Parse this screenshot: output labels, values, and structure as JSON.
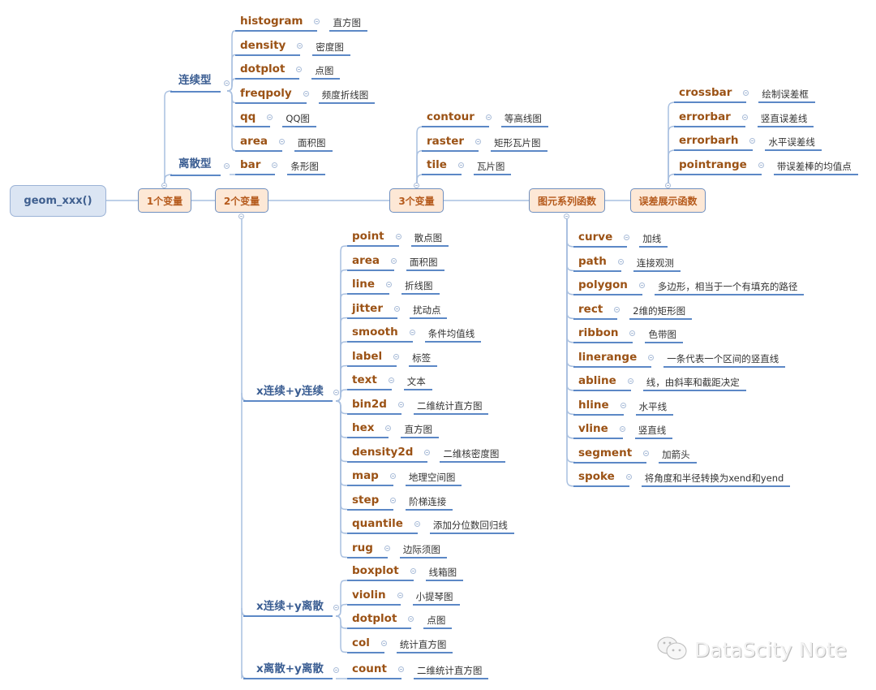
{
  "root": {
    "label": "geom_xxx()"
  },
  "categories": [
    {
      "id": "one_var",
      "label": "1个变量"
    },
    {
      "id": "two_var",
      "label": "2个变量"
    },
    {
      "id": "three_var",
      "label": "3个变量"
    },
    {
      "id": "primitives",
      "label": "图元系列函数"
    },
    {
      "id": "errors",
      "label": "误差展示函数"
    }
  ],
  "one_var": {
    "groups": [
      {
        "label": "连续型",
        "items": [
          {
            "key": "histogram",
            "desc": "直方图"
          },
          {
            "key": "density",
            "desc": "密度图"
          },
          {
            "key": "dotplot",
            "desc": "点图"
          },
          {
            "key": "freqpoly",
            "desc": "频度折线图"
          },
          {
            "key": "qq",
            "desc": "QQ图"
          },
          {
            "key": "area",
            "desc": "面积图"
          }
        ]
      },
      {
        "label": "离散型",
        "items": [
          {
            "key": "bar",
            "desc": "条形图"
          }
        ]
      }
    ]
  },
  "two_var": {
    "groups": [
      {
        "label": "x连续+y连续",
        "items": [
          {
            "key": "point",
            "desc": "散点图"
          },
          {
            "key": "area",
            "desc": "面积图"
          },
          {
            "key": "line",
            "desc": "折线图"
          },
          {
            "key": "jitter",
            "desc": "扰动点"
          },
          {
            "key": "smooth",
            "desc": "条件均值线"
          },
          {
            "key": "label",
            "desc": "标签"
          },
          {
            "key": "text",
            "desc": "文本"
          },
          {
            "key": "bin2d",
            "desc": "二维统计直方图"
          },
          {
            "key": "hex",
            "desc": "直方图"
          },
          {
            "key": "density2d",
            "desc": "二维核密度图"
          },
          {
            "key": "map",
            "desc": "地理空间图"
          },
          {
            "key": "step",
            "desc": "阶梯连接"
          },
          {
            "key": "quantile",
            "desc": "添加分位数回归线"
          },
          {
            "key": "rug",
            "desc": "边际须图"
          }
        ]
      },
      {
        "label": "x连续+y离散",
        "items": [
          {
            "key": "boxplot",
            "desc": "线箱图"
          },
          {
            "key": "violin",
            "desc": "小提琴图"
          },
          {
            "key": "dotplot",
            "desc": "点图"
          },
          {
            "key": "col",
            "desc": "统计直方图"
          }
        ]
      },
      {
        "label": "x离散+y离散",
        "items": [
          {
            "key": "count",
            "desc": "二维统计直方图"
          }
        ]
      }
    ]
  },
  "three_var": {
    "items": [
      {
        "key": "contour",
        "desc": "等高线图"
      },
      {
        "key": "raster",
        "desc": "矩形瓦片图"
      },
      {
        "key": "tile",
        "desc": "瓦片图"
      }
    ]
  },
  "primitives": {
    "items": [
      {
        "key": "curve",
        "desc": "加线"
      },
      {
        "key": "path",
        "desc": "连接观测"
      },
      {
        "key": "polygon",
        "desc": "多边形，相当于一个有填充的路径"
      },
      {
        "key": "rect",
        "desc": "2维的矩形图"
      },
      {
        "key": "ribbon",
        "desc": "色带图"
      },
      {
        "key": "linerange",
        "desc": "一条代表一个区间的竖直线"
      },
      {
        "key": "abline",
        "desc": "线，由斜率和截距决定"
      },
      {
        "key": "hline",
        "desc": "水平线"
      },
      {
        "key": "vline",
        "desc": "竖直线"
      },
      {
        "key": "segment",
        "desc": "加箭头"
      },
      {
        "key": "spoke",
        "desc": "将角度和半径转换为xend和yend"
      }
    ]
  },
  "errors": {
    "items": [
      {
        "key": "crossbar",
        "desc": "绘制误差框"
      },
      {
        "key": "errorbar",
        "desc": "竖直误差线"
      },
      {
        "key": "errorbarh",
        "desc": "水平误差线"
      },
      {
        "key": "pointrange",
        "desc": "带误差棒的均值点"
      }
    ]
  },
  "colors": {
    "line": "#5c88c6",
    "key_text": "#9b5215",
    "group_text": "#3a5d92",
    "category_fill": "#fde8d6",
    "root_fill": "#dbe5f3"
  },
  "watermark": {
    "text": "DataScity Note",
    "icon": "wechat-icon"
  }
}
